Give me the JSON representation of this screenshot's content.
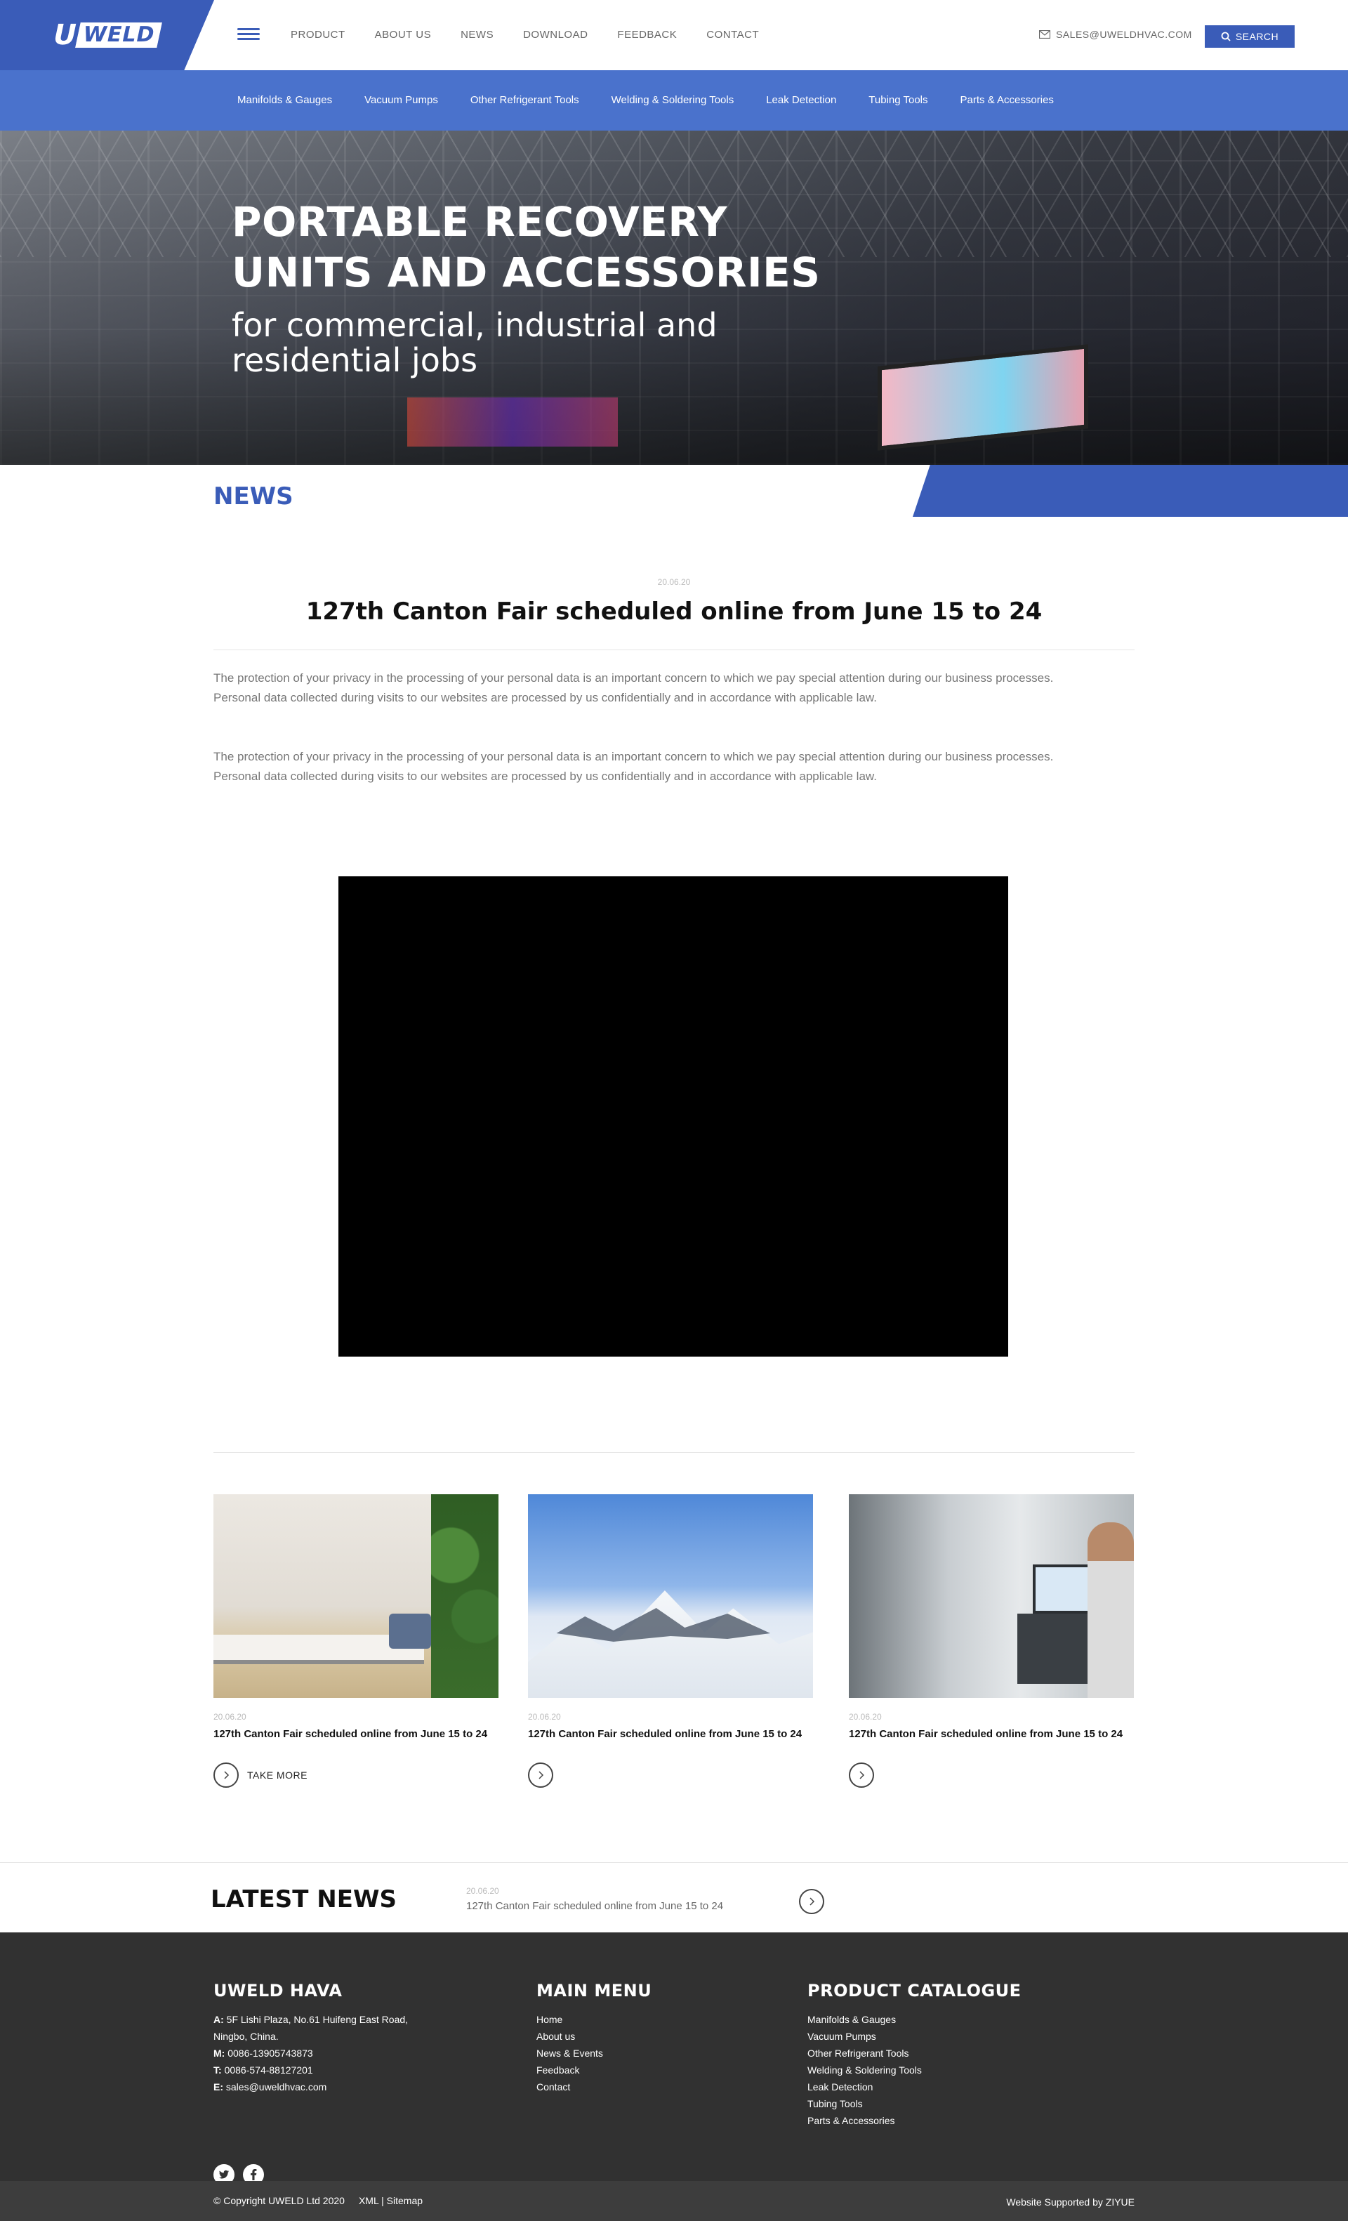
{
  "header": {
    "logo_letter": "U",
    "logo_rest": "WELD",
    "nav": [
      "PRODUCT",
      "ABOUT US",
      "NEWS",
      "DOWNLOAD",
      "FEEDBACK",
      "CONTACT"
    ],
    "email": "SALES@UWELDHVAC.COM",
    "search_label": "SEARCH",
    "accent_color": "#3a5cb8"
  },
  "categories": [
    "Manifolds & Gauges",
    "Vacuum Pumps",
    "Other Refrigerant Tools",
    "Welding & Soldering Tools",
    "Leak Detection",
    "Tubing Tools",
    "Parts & Accessories"
  ],
  "hero": {
    "title_line1": "PORTABLE RECOVERY",
    "title_line2": "UNITS AND ACCESSORIES",
    "subtitle_line1": "for commercial, industrial and",
    "subtitle_line2": "residential jobs"
  },
  "section_label": "NEWS",
  "article": {
    "date": "20.06.20",
    "title": "127th Canton Fair scheduled online from June 15 to 24",
    "paragraphs": [
      "The protection of your privacy in the processing of your personal data is an important concern to which we pay special attention during our business processes. Personal data collected during visits to our websites are processed by us confidentially and in accordance with applicable law.",
      "The protection of your privacy in the processing of your personal data is an important concern to which we pay special attention during our business processes. Personal data collected during visits to our websites are processed by us confidentially and in accordance with applicable law."
    ]
  },
  "cards": [
    {
      "date": "20.06.20",
      "title": "127th Canton Fair scheduled online from June 15 to 24",
      "more_label": "TAKE MORE"
    },
    {
      "date": "20.06.20",
      "title": "127th Canton Fair scheduled online from June 15 to 24",
      "more_label": ""
    },
    {
      "date": "20.06.20",
      "title": "127th Canton Fair scheduled online from June 15 to 24",
      "more_label": ""
    }
  ],
  "latest": {
    "title": "LATEST NEWS",
    "date": "20.06.20",
    "text": "127th Canton Fair scheduled online from June 15 to 24"
  },
  "footer": {
    "company": {
      "title": "UWELD HAVA",
      "address_label": "A:",
      "address_line1": "5F Lishi Plaza, No.61 Huifeng East Road,",
      "address_line2": "Ningbo, China.",
      "mobile_label": "M:",
      "mobile": "0086-13905743873",
      "tel_label": "T:",
      "tel": "0086-574-88127201",
      "email_label": "E:",
      "email": "sales@uweldhvac.com"
    },
    "menu": {
      "title": "MAIN MENU",
      "items": [
        "Home",
        "About us",
        "News & Events",
        "Feedback",
        "Contact"
      ]
    },
    "catalogue": {
      "title": "PRODUCT CATALOGUE",
      "items": [
        "Manifolds & Gauges",
        "Vacuum Pumps",
        "Other Refrigerant Tools",
        "Welding & Soldering Tools",
        "Leak Detection",
        "Tubing Tools",
        "Parts & Accessories"
      ]
    },
    "social_icons": [
      "twitter-icon",
      "facebook-icon"
    ]
  },
  "bottom": {
    "copyright": "© Copyright UWELD Ltd 2020",
    "links": "XML | Sitemap",
    "credit": "Website Supported by ZIYUE"
  }
}
